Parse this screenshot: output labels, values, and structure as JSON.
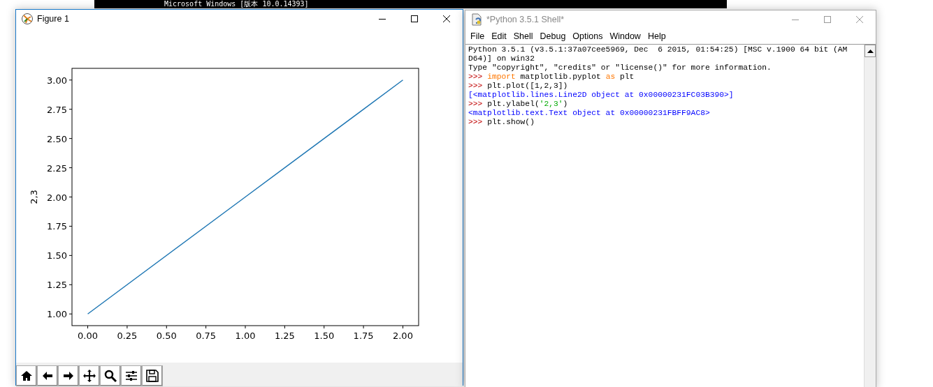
{
  "console_window": {
    "text": "Microsoft Windows [版本 10.0.14393]"
  },
  "figure_window": {
    "title": "Figure 1",
    "active": true,
    "chart_data": {
      "type": "line",
      "ylabel": "2,3",
      "x": [
        0,
        1,
        2
      ],
      "series": [
        {
          "color": "#1f77b4",
          "values": [
            1,
            2,
            3
          ]
        }
      ],
      "xlim": [
        -0.1,
        2.1
      ],
      "ylim": [
        0.9,
        3.1
      ],
      "xticks": [
        {
          "value": 0,
          "label": "0.00"
        },
        {
          "value": 0.25,
          "label": "0.25"
        },
        {
          "value": 0.5,
          "label": "0.50"
        },
        {
          "value": 0.75,
          "label": "0.75"
        },
        {
          "value": 1,
          "label": "1.00"
        },
        {
          "value": 1.25,
          "label": "1.25"
        },
        {
          "value": 1.5,
          "label": "1.50"
        },
        {
          "value": 1.75,
          "label": "1.75"
        },
        {
          "value": 2,
          "label": "2.00"
        }
      ],
      "yticks": [
        {
          "value": 1,
          "label": "1.00"
        },
        {
          "value": 1.25,
          "label": "1.25"
        },
        {
          "value": 1.5,
          "label": "1.50"
        },
        {
          "value": 1.75,
          "label": "1.75"
        },
        {
          "value": 2,
          "label": "2.00"
        },
        {
          "value": 2.25,
          "label": "2.25"
        },
        {
          "value": 2.5,
          "label": "2.50"
        },
        {
          "value": 2.75,
          "label": "2.75"
        },
        {
          "value": 3,
          "label": "3.00"
        }
      ]
    },
    "toolbar": [
      {
        "kind": "home"
      },
      {
        "kind": "back"
      },
      {
        "kind": "forward"
      },
      {
        "kind": "pan"
      },
      {
        "kind": "zoom"
      },
      {
        "kind": "configure"
      },
      {
        "kind": "save"
      }
    ]
  },
  "shell_window": {
    "title": "*Python 3.5.1 Shell*",
    "active": false,
    "menu": [
      "File",
      "Edit",
      "Shell",
      "Debug",
      "Options",
      "Window",
      "Help"
    ],
    "lines": [
      [
        {
          "kind": "output",
          "text": "Python 3.5.1 (v3.5.1:37a07cee5969, Dec  6 2015, 01:54:25) [MSC v.1900 64 bit (AM"
        }
      ],
      [
        {
          "kind": "output",
          "text": "D64)] on win32"
        }
      ],
      [
        {
          "kind": "output",
          "text": "Type \"copyright\", \"credits\" or \"license()\" for more information."
        }
      ],
      [
        {
          "kind": "prompt",
          "text": ">>> "
        },
        {
          "kind": "keyword",
          "text": "import"
        },
        {
          "kind": "output",
          "text": " matplotlib.pyplot "
        },
        {
          "kind": "keyword",
          "text": "as"
        },
        {
          "kind": "output",
          "text": " plt"
        }
      ],
      [
        {
          "kind": "prompt",
          "text": ">>> "
        },
        {
          "kind": "output",
          "text": "plt.plot([1,2,3])"
        }
      ],
      [
        {
          "kind": "stdout",
          "text": "[<matplotlib.lines.Line2D object at 0x00000231FC03B390>]"
        }
      ],
      [
        {
          "kind": "prompt",
          "text": ">>> "
        },
        {
          "kind": "output",
          "text": "plt.ylabel("
        },
        {
          "kind": "string",
          "text": "'2,3'"
        },
        {
          "kind": "output",
          "text": ")"
        }
      ],
      [
        {
          "kind": "stdout",
          "text": "<matplotlib.text.Text object at 0x00000231FBFF9AC8>"
        }
      ],
      [
        {
          "kind": "prompt",
          "text": ">>> "
        },
        {
          "kind": "output",
          "text": "plt.show()"
        }
      ]
    ]
  }
}
